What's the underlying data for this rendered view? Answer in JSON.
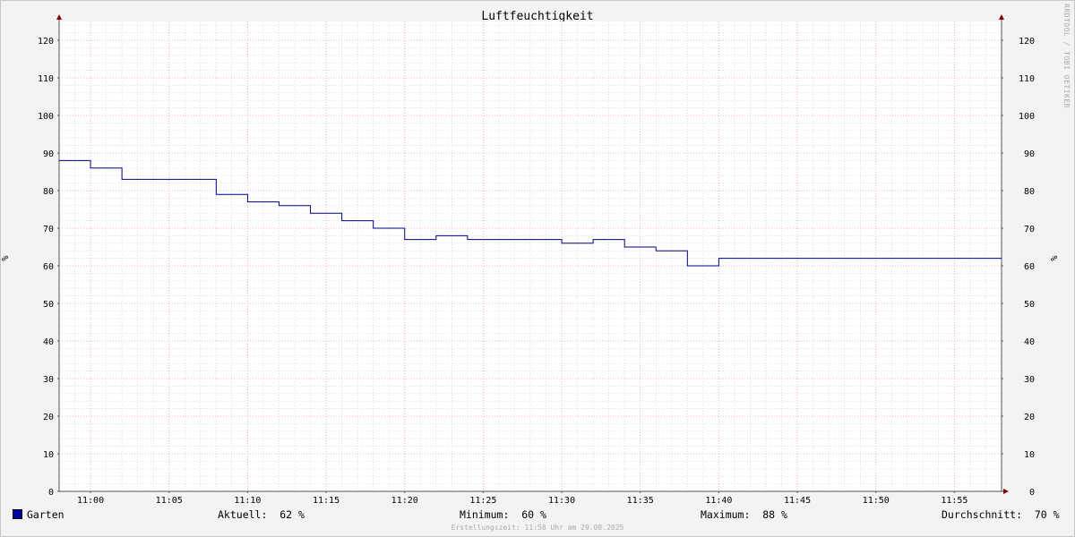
{
  "title": "Luftfeuchtigkeit",
  "watermark": "RRDTOOL / TOBI OETIKER",
  "footer": "Erstellungszeit: 11:58 Uhr am 29.08.2025",
  "colors": {
    "series": "#000080",
    "grid_major": "#e6a0a0",
    "grid_minor": "#c8c8c8",
    "axis": "#555555",
    "arrow": "#800000",
    "background": "#f3f3f3",
    "plot": "#ffffff"
  },
  "legend": {
    "series_name": "Garten",
    "current_label": "Aktuell:",
    "current_value": "62 %",
    "min_label": "Minimum:",
    "min_value": "60 %",
    "max_label": "Maximum:",
    "max_value": "88 %",
    "avg_label": "Durchschnitt:",
    "avg_value": "70 %"
  },
  "chart_data": {
    "type": "line",
    "title": "Luftfeuchtigkeit",
    "ylabel_left": "%",
    "ylabel_right": "%",
    "ylim": [
      0,
      125
    ],
    "y_ticks": [
      0,
      10,
      20,
      30,
      40,
      50,
      60,
      70,
      80,
      90,
      100,
      110,
      120
    ],
    "xlim": [
      "10:58",
      "11:58"
    ],
    "x_ticks": [
      "11:00",
      "11:05",
      "11:10",
      "11:15",
      "11:20",
      "11:25",
      "11:30",
      "11:35",
      "11:40",
      "11:45",
      "11:50",
      "11:55"
    ],
    "grid": true,
    "series": [
      {
        "name": "Garten",
        "step": true,
        "x": [
          "10:58",
          "11:00",
          "11:02",
          "11:08",
          "11:10",
          "11:12",
          "11:14",
          "11:16",
          "11:18",
          "11:20",
          "11:22",
          "11:24",
          "11:30",
          "11:32",
          "11:34",
          "11:36",
          "11:38",
          "11:40",
          "11:58"
        ],
        "y": [
          88,
          86,
          83,
          79,
          77,
          76,
          74,
          72,
          70,
          67,
          68,
          67,
          66,
          67,
          65,
          64,
          60,
          62,
          62
        ]
      }
    ]
  }
}
